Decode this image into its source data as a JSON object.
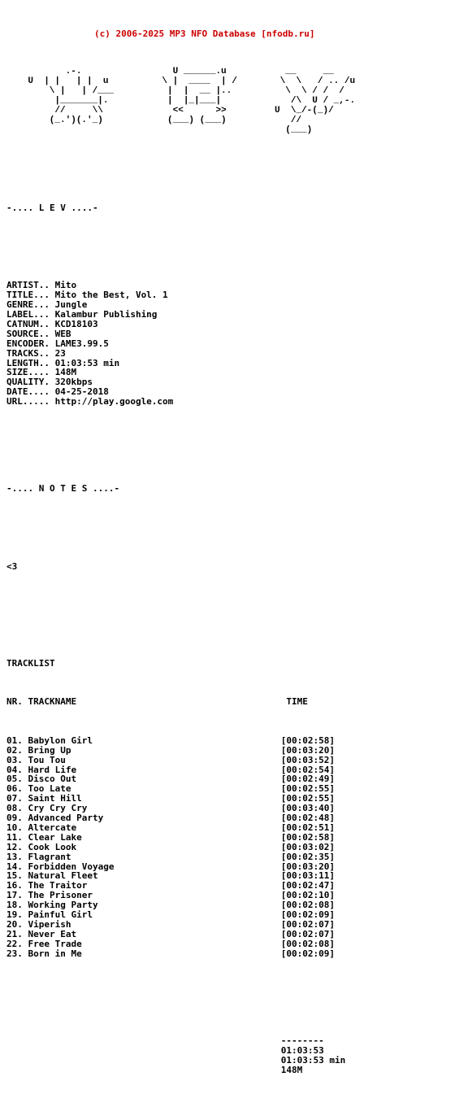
{
  "header": {
    "copyright": "(c) 2006-2025 MP3 NFO Database [nfodb.ru]",
    "color": "#cc0000"
  },
  "ascii_art": {
    "lines": [
      "           .-.                 U ______.u           __     __",
      "    U  | |   | |  u          \\ |  ____  | /        \\  \\   / .. /u",
      "        \\ |   | /___          |  |  __ |..          \\  \\ / /  /",
      "         |_______|.           |  |_|___|             /\\  U / _,-.",
      "         //     \\\\             <<      >>         U  \\_/-(_)/",
      "        (_.')(.'_)            (___) (___)            //",
      "                                                    (___)"
    ],
    "raw": "logo-ascii-art"
  },
  "sections": {
    "info_header": "-.... L E V ....-",
    "notes_header": "-.... N O T E S ....-",
    "notes_body": "<3",
    "tracklist_header": "TRACKLIST"
  },
  "info": {
    "fields": [
      {
        "label": "ARTIST..",
        "value": "Mito"
      },
      {
        "label": "TITLE...",
        "value": "Mito the Best, Vol. 1"
      },
      {
        "label": "GENRE...",
        "value": "Jungle"
      },
      {
        "label": "LABEL...",
        "value": "Kalambur Publishing"
      },
      {
        "label": "CATNUM..",
        "value": "KCD18103"
      },
      {
        "label": "SOURCE..",
        "value": "WEB"
      },
      {
        "label": "ENCODER.",
        "value": "LAME3.99.5"
      },
      {
        "label": "TRACKS..",
        "value": "23"
      },
      {
        "label": "LENGTH..",
        "value": "01:03:53 min"
      },
      {
        "label": "SIZE....",
        "value": "148M"
      },
      {
        "label": "QUALITY.",
        "value": "320kbps"
      },
      {
        "label": "DATE....",
        "value": "04-25-2018"
      },
      {
        "label": "URL.....",
        "value": "http://play.google.com"
      }
    ]
  },
  "tracklist": {
    "columns": {
      "nr": "NR.",
      "trackname": "TRACKNAME",
      "time": "TIME"
    },
    "tracks": [
      {
        "nr": "01.",
        "name": "Babylon Girl",
        "time": "[00:02:58]"
      },
      {
        "nr": "02.",
        "name": "Bring Up",
        "time": "[00:03:20]"
      },
      {
        "nr": "03.",
        "name": "Tou Tou",
        "time": "[00:03:52]"
      },
      {
        "nr": "04.",
        "name": "Hard Life",
        "time": "[00:02:54]"
      },
      {
        "nr": "05.",
        "name": "Disco Out",
        "time": "[00:02:49]"
      },
      {
        "nr": "06.",
        "name": "Too Late",
        "time": "[00:02:55]"
      },
      {
        "nr": "07.",
        "name": "Saint Hill",
        "time": "[00:02:55]"
      },
      {
        "nr": "08.",
        "name": "Cry Cry Cry",
        "time": "[00:03:40]"
      },
      {
        "nr": "09.",
        "name": "Advanced Party",
        "time": "[00:02:48]"
      },
      {
        "nr": "10.",
        "name": "Altercate",
        "time": "[00:02:51]"
      },
      {
        "nr": "11.",
        "name": "Clear Lake",
        "time": "[00:02:58]"
      },
      {
        "nr": "12.",
        "name": "Cook Look",
        "time": "[00:03:02]"
      },
      {
        "nr": "13.",
        "name": "Flagrant",
        "time": "[00:02:35]"
      },
      {
        "nr": "14.",
        "name": "Forbidden Voyage",
        "time": "[00:03:20]"
      },
      {
        "nr": "15.",
        "name": "Natural Fleet",
        "time": "[00:03:11]"
      },
      {
        "nr": "16.",
        "name": "The Traitor",
        "time": "[00:02:47]"
      },
      {
        "nr": "17.",
        "name": "The Prisoner",
        "time": "[00:02:10]"
      },
      {
        "nr": "18.",
        "name": "Working Party",
        "time": "[00:02:08]"
      },
      {
        "nr": "19.",
        "name": "Painful Girl",
        "time": "[00:02:09]"
      },
      {
        "nr": "20.",
        "name": "Viperish",
        "time": "[00:02:07]"
      },
      {
        "nr": "21.",
        "name": "Never Eat",
        "time": "[00:02:07]"
      },
      {
        "nr": "22.",
        "name": "Free Trade",
        "time": "[00:02:08]"
      },
      {
        "nr": "23.",
        "name": "Born in Me",
        "time": "[00:02:09]"
      }
    ]
  },
  "summary": {
    "rule": "--------",
    "total_time": "01:03:53",
    "total_time_min": "01:03:53 min",
    "total_size": "148M"
  }
}
